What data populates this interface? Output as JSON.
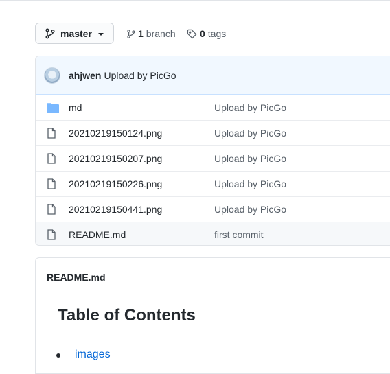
{
  "toolbar": {
    "branch_name": "master",
    "branches_count": "1",
    "branches_label": "branch",
    "tags_count": "0",
    "tags_label": "tags"
  },
  "latest_commit": {
    "author": "ahjwen",
    "message": "Upload by PicGo"
  },
  "files": [
    {
      "type": "folder",
      "name": "md",
      "commit": "Upload by PicGo"
    },
    {
      "type": "file",
      "name": "20210219150124.png",
      "commit": "Upload by PicGo"
    },
    {
      "type": "file",
      "name": "20210219150207.png",
      "commit": "Upload by PicGo"
    },
    {
      "type": "file",
      "name": "20210219150226.png",
      "commit": "Upload by PicGo"
    },
    {
      "type": "file",
      "name": "20210219150441.png",
      "commit": "Upload by PicGo"
    },
    {
      "type": "file",
      "name": "README.md",
      "commit": "first commit"
    }
  ],
  "readme": {
    "filename": "README.md",
    "heading": "Table of Contents",
    "items": [
      "images"
    ]
  },
  "colors": {
    "accent_link": "#0366d6",
    "folder_icon": "#79b8ff",
    "header_bg": "#f1f8ff"
  }
}
